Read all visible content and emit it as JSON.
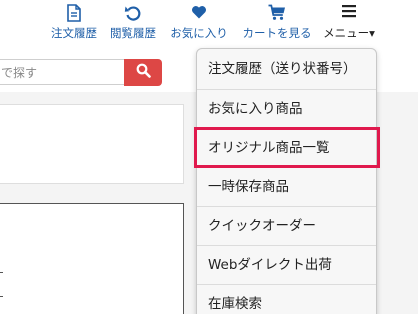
{
  "nav": {
    "order_history": "注文履歴",
    "browsing_history": "閲覧履歴",
    "favorites": "お気に入り",
    "view_cart": "カートを見る",
    "menu": "メニュー▾"
  },
  "search": {
    "placeholder": "で探す"
  },
  "dropdown": {
    "items": [
      "注文履歴（送り状番号）",
      "お気に入り商品",
      "オリジナル商品一覧",
      "一時保存商品",
      "クイックオーダー",
      "Webダイレクト出荷",
      "在庫検索"
    ],
    "highlighted_index": 2
  },
  "colors": {
    "nav_text": "#1f5fa8",
    "search_button": "#dd4745",
    "highlight": "#e0194d"
  },
  "icons": {
    "order_history": "document-icon",
    "browsing_history": "history-icon",
    "favorites": "heart-icon",
    "view_cart": "cart-icon",
    "menu": "hamburger-icon",
    "search": "magnifier-icon"
  }
}
